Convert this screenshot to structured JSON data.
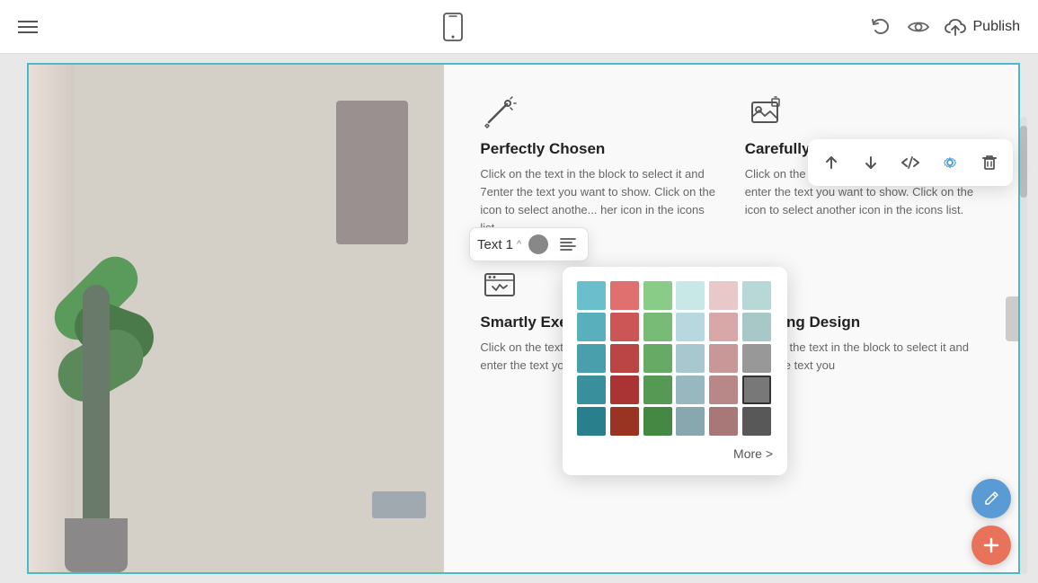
{
  "toolbar": {
    "publish_label": "Publish",
    "undo_title": "Undo",
    "preview_title": "Preview",
    "upload_title": "Upload",
    "menu_title": "Menu"
  },
  "element_toolbar": {
    "move_up": "Move Up",
    "move_down": "Move Down",
    "code": "Code",
    "settings": "Settings",
    "delete": "Delete"
  },
  "text_toolbar": {
    "label": "Text 1",
    "caret": "^",
    "color_title": "Text Color",
    "align_title": "Align"
  },
  "color_picker": {
    "more_label": "More >",
    "colors": [
      "#6bbfcc",
      "#e07070",
      "#88cc88",
      "#c8e8e8",
      "#e8c8c8",
      "#b8d8d8",
      "#5aafbc",
      "#cc5555",
      "#77bb77",
      "#b8d8e0",
      "#d8a8a8",
      "#a8c8c8",
      "#4a9fac",
      "#bb4444",
      "#66aa66",
      "#a8c8d0",
      "#c89898",
      "#989898",
      "#3a8f9c",
      "#aa3333",
      "#559955",
      "#98b8c0",
      "#b88888",
      "#787878",
      "#2a7f8c",
      "#993322",
      "#448844",
      "#88a8b0",
      "#a87878",
      "#585858"
    ],
    "selected_index": 23
  },
  "features": [
    {
      "id": "perfectly-chosen",
      "icon_name": "wand-icon",
      "title": "Perfectly Chosen",
      "text": "Click on the text in the block to select it and 7enter the text you want to show. Click on the icon to select anothe... her icon in the icons list."
    },
    {
      "id": "carefully-planned",
      "icon_name": "gallery-icon",
      "title": "Carefully Planned",
      "text": "Click on the text in the block to select it and enter the text you want to show. Click on the icon to select another icon in the icons list."
    },
    {
      "id": "smartly-execute",
      "icon_name": "browser-icon",
      "title": "Smartly Execute",
      "text": "Click on the text in the block to select it and enter the text you"
    },
    {
      "id": "lighting-design",
      "icon_name": "bulb-icon",
      "title": "Lighting Design",
      "text": "Click on the text in the block to select it and enter the text you"
    }
  ]
}
